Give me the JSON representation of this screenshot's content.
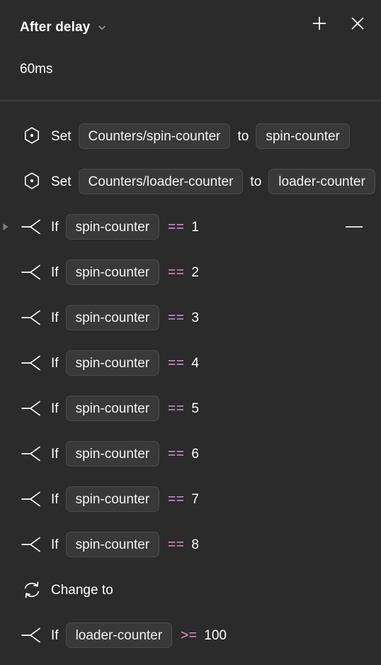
{
  "header": {
    "title": "After delay",
    "chevron_icon": "chevron-down-icon",
    "add_icon": "plus-icon",
    "close_icon": "close-icon",
    "delay_value": "60ms"
  },
  "colors": {
    "background": "#2b2b2b",
    "pill_background": "#393939",
    "pill_border": "#4a4a4a",
    "divider": "#3c3c3c",
    "operator_accent": "#e49fd8",
    "text": "#ffffff",
    "muted": "#8c8c8c"
  },
  "rows": [
    {
      "icon": "variable-hexagon-icon",
      "type": "set",
      "keyword": "Set",
      "target": "Counters/spin-counter",
      "connector": "to",
      "value": "spin-counter",
      "disclosure": false,
      "trailing_dash": false
    },
    {
      "icon": "variable-hexagon-icon",
      "type": "set",
      "keyword": "Set",
      "target": "Counters/loader-counter",
      "connector": "to",
      "value": "loader-counter",
      "disclosure": false,
      "trailing_dash": false
    },
    {
      "icon": "conditional-branch-icon",
      "type": "if",
      "keyword": "If",
      "variable": "spin-counter",
      "operator": "==",
      "operand": "1",
      "disclosure": true,
      "trailing_dash": true
    },
    {
      "icon": "conditional-branch-icon",
      "type": "if",
      "keyword": "If",
      "variable": "spin-counter",
      "operator": "==",
      "operand": "2",
      "disclosure": false,
      "trailing_dash": false
    },
    {
      "icon": "conditional-branch-icon",
      "type": "if",
      "keyword": "If",
      "variable": "spin-counter",
      "operator": "==",
      "operand": "3",
      "disclosure": false,
      "trailing_dash": false
    },
    {
      "icon": "conditional-branch-icon",
      "type": "if",
      "keyword": "If",
      "variable": "spin-counter",
      "operator": "==",
      "operand": "4",
      "disclosure": false,
      "trailing_dash": false
    },
    {
      "icon": "conditional-branch-icon",
      "type": "if",
      "keyword": "If",
      "variable": "spin-counter",
      "operator": "==",
      "operand": "5",
      "disclosure": false,
      "trailing_dash": false
    },
    {
      "icon": "conditional-branch-icon",
      "type": "if",
      "keyword": "If",
      "variable": "spin-counter",
      "operator": "==",
      "operand": "6",
      "disclosure": false,
      "trailing_dash": false
    },
    {
      "icon": "conditional-branch-icon",
      "type": "if",
      "keyword": "If",
      "variable": "spin-counter",
      "operator": "==",
      "operand": "7",
      "disclosure": false,
      "trailing_dash": false
    },
    {
      "icon": "conditional-branch-icon",
      "type": "if",
      "keyword": "If",
      "variable": "spin-counter",
      "operator": "==",
      "operand": "8",
      "disclosure": false,
      "trailing_dash": false
    },
    {
      "icon": "refresh-sync-icon",
      "type": "label",
      "keyword": "Change to",
      "disclosure": false,
      "trailing_dash": false
    },
    {
      "icon": "conditional-branch-icon",
      "type": "if",
      "keyword": "If",
      "variable": "loader-counter",
      "operator": ">=",
      "operand": "100",
      "disclosure": false,
      "trailing_dash": false
    }
  ]
}
